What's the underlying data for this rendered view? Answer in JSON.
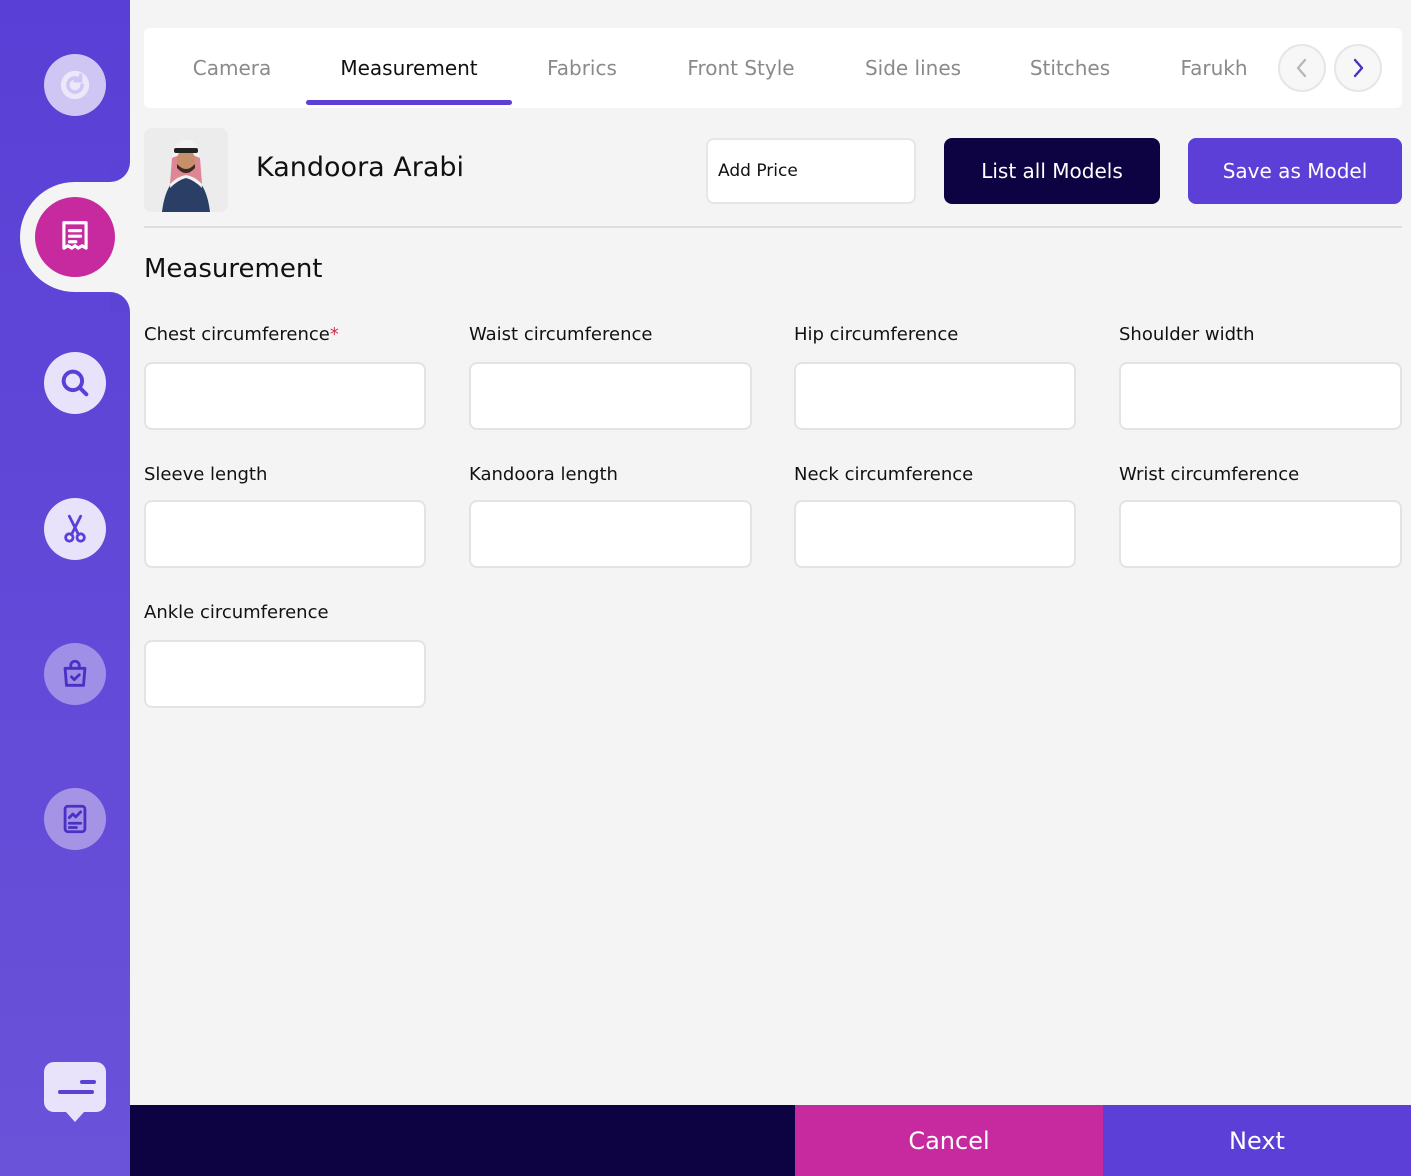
{
  "tabs": [
    {
      "label": "Camera",
      "active": false
    },
    {
      "label": "Measurement",
      "active": true
    },
    {
      "label": "Fabrics",
      "active": false
    },
    {
      "label": "Front Style",
      "active": false
    },
    {
      "label": "Side lines",
      "active": false
    },
    {
      "label": "Stitches",
      "active": false
    },
    {
      "label": "Farukh",
      "active": false
    }
  ],
  "header": {
    "model_name": "Kandoora Arabi",
    "price_placeholder": "Add Price",
    "list_models_label": "List all Models",
    "save_model_label": "Save as Model"
  },
  "section": {
    "title": "Measurement",
    "fields": [
      {
        "label": "Chest circumference",
        "required": true,
        "value": ""
      },
      {
        "label": "Waist circumference",
        "required": false,
        "value": ""
      },
      {
        "label": "Hip circumference",
        "required": false,
        "value": ""
      },
      {
        "label": "Shoulder width",
        "required": false,
        "value": ""
      },
      {
        "label": "Sleeve length",
        "required": false,
        "value": ""
      },
      {
        "label": "Kandoora length",
        "required": false,
        "value": ""
      },
      {
        "label": "Neck circumference",
        "required": false,
        "value": ""
      },
      {
        "label": "Wrist circumference",
        "required": false,
        "value": ""
      },
      {
        "label": "Ankle circumference",
        "required": false,
        "value": ""
      }
    ],
    "required_mark": "*"
  },
  "sidebar": {
    "items": [
      {
        "icon": "refresh-icon"
      },
      {
        "icon": "orders-icon",
        "active": true
      },
      {
        "icon": "search-icon"
      },
      {
        "icon": "scissors-icon"
      },
      {
        "icon": "shopping-bag-icon"
      },
      {
        "icon": "report-icon"
      },
      {
        "icon": "chat-icon"
      }
    ]
  },
  "footer": {
    "cancel_label": "Cancel",
    "next_label": "Next"
  },
  "colors": {
    "primary": "#5b3fd6",
    "accent": "#c7299f",
    "dark": "#0d0342",
    "background": "#f4f4f4"
  }
}
